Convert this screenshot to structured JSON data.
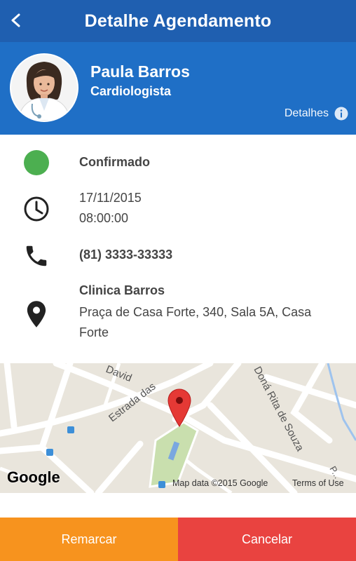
{
  "header": {
    "title": "Detalhe Agendamento"
  },
  "doctor": {
    "name": "Paula Barros",
    "specialty": "Cardiologista",
    "details_label": "Detalhes"
  },
  "appointment": {
    "status": "Confirmado",
    "date": "17/11/2015",
    "time": "08:00:00",
    "phone": "(81) 3333-33333",
    "clinic_name": "Clinica Barros",
    "address": "Praça de Casa Forte, 340, Sala 5A, Casa Forte"
  },
  "map": {
    "street_1": "David",
    "street_2": "Estrada das",
    "street_3": "Doná Rita de Souza",
    "street_4": "P...",
    "logo": "Google",
    "attribution": "Map data ©2015 Google",
    "terms": "Terms of Use"
  },
  "actions": {
    "reschedule_label": "Remarcar",
    "cancel_label": "Cancelar"
  },
  "colors": {
    "header": "#1f5fb0",
    "profile_band": "#1f6fc6",
    "status": "#4caf50",
    "reschedule": "#f7931e",
    "cancel": "#e94340",
    "map_pin": "#e53935"
  },
  "icons": {
    "back": "chevron-left-icon",
    "info": "info-icon",
    "status": "status-dot-icon",
    "clock": "clock-icon",
    "phone": "phone-icon",
    "location": "location-pin-icon"
  }
}
